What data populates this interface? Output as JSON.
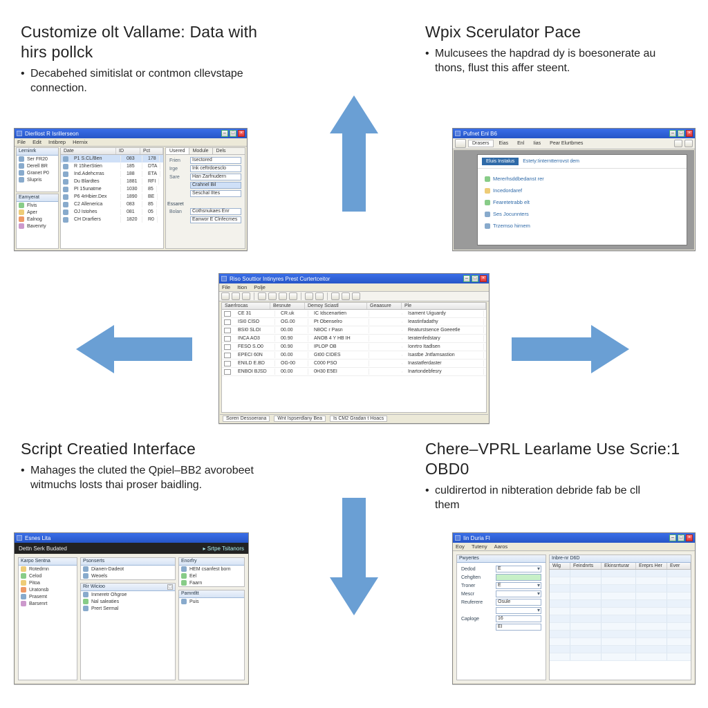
{
  "layout": {
    "arrows": [
      "up",
      "down",
      "left",
      "right"
    ]
  },
  "panels": {
    "topLeft": {
      "title": "Customize olt Vallame: Data with hirs pollck",
      "bullet": "Decabehed simitislat or contmon cllevstape connection.",
      "win": {
        "title": "Dierllost R Isrillerseon",
        "menus": [
          "File",
          "Edit",
          "Intibrep",
          "Hernix"
        ],
        "tree1_header": "Lerninrk",
        "tree1": [
          "Ser FR20",
          "Derell BR",
          "Granet P0",
          "Slupris"
        ],
        "tree2_header": "Eamyerat",
        "tree2": [
          "Flvis",
          "Aper",
          "Ealnog",
          "Bavenrty"
        ],
        "list_cols": [
          "Date",
          "ID",
          "Pct"
        ],
        "list": [
          [
            "P1 S.CL/Ben",
            "083",
            "178"
          ],
          [
            "R 15herStien",
            "185",
            "DTA"
          ],
          [
            "Ind.Adehcrras",
            "188",
            "ETA"
          ],
          [
            "Du Blardtes",
            "1881",
            "RFI"
          ],
          [
            "PI 15unatme",
            "1030",
            "85"
          ],
          [
            "P6 4rHbier.Dex",
            "1890",
            "BE"
          ],
          [
            "C2 Allenerica",
            "083",
            "85"
          ],
          [
            "OJ Istohes",
            "081",
            "05"
          ],
          [
            "CH Drarfiers",
            "1820",
            "R0"
          ]
        ],
        "propTabs": [
          "Usered",
          "Module",
          "Dels"
        ],
        "props": [
          [
            "Frien",
            "Isectored"
          ],
          [
            "Irge",
            "Ink ceftrdoesclo"
          ],
          [
            "Sare",
            "Han Zarfnudern"
          ],
          [
            "",
            "Crahnel Bil"
          ],
          [
            "",
            "Seschal IItes"
          ]
        ],
        "props2_label": "Essaret",
        "props2": [
          [
            "Bolan",
            "Cothsnukaes Enr"
          ],
          [
            "",
            "Eanwor E Clnfecmes"
          ]
        ]
      }
    },
    "topRight": {
      "title": "Wpix Scerulator Pace",
      "bullet": "Mulcusees the hapdrad dy is boesonerate au thons, flust this affer steent.",
      "win": {
        "title": "Pufnet Enl B6",
        "tabs": [
          "Drasers",
          "Eias",
          "Enl",
          "Iias",
          "Pear Elurtbmes"
        ],
        "headerBtn": "Eluis Instalus",
        "headerLink": "Estety:Iinterntterrovst dem",
        "items": [
          "Mererhsddbedanst rer",
          "Incedordaref",
          "Fearetetrabb elt",
          "Ses Jocunnters",
          "Trzemso hirnem"
        ]
      }
    },
    "center": {
      "title": "Riso Souttior Intinyres Prest Curtertceitor",
      "menus": [
        "File",
        "Ition",
        "Polje"
      ],
      "listCols": [
        "Saerlrocas",
        "Besnute",
        "Demoy Sciastl",
        "Geaasure",
        "Ple"
      ],
      "status": [
        "Soren Dessoerana",
        "Wnt Ispserdlany Bea",
        "Is CM2 Gradan t Hoacs"
      ],
      "rows": [
        [
          "CE 31",
          "CR.uk",
          "IC Idscenartien",
          "Isament Uiguardy",
          ""
        ],
        [
          "ISI0 ClSO",
          "OG.00",
          "Pt Obenselro",
          "Ieastinfadathy",
          ""
        ],
        [
          "BSI0 SLOI",
          "00.00",
          "N8OC r Pasn",
          "Reaturstsence Goeeetle",
          ""
        ],
        [
          "INCA AO3",
          "00.90",
          "ANOB 4 Y HB IH",
          "Ieratenfedstary",
          ""
        ],
        [
          "FESO S.O0",
          "00.90",
          "IPLOP OB",
          "Ionrtro Itadlsen",
          ""
        ],
        [
          "EPECI 60N",
          "00.00",
          "Gt00 CIDES",
          "Isastbe Jntfamsastion",
          ""
        ],
        [
          "ENILD E.BD",
          "OG-00",
          "C000 PSO",
          "Inastatferdaster",
          ""
        ],
        [
          "ENBOI BJSD",
          "00.00",
          "0H30 E5EI",
          "Inartondebfesry",
          ""
        ]
      ]
    },
    "botLeft": {
      "title": "Script Creatied Interface",
      "bullet": "Mahages the cluted the Qpiel–BB2 avorobeet witmuchs losts thai proser baidling.",
      "win": {
        "title": "Esnes Lita",
        "banner": "Dettn Serk Budated",
        "bannerRight": "Srtpe Tsitanors",
        "leftHeader": "Karpo Sentna",
        "leftItems": [
          "Rotedrnn",
          "Celod",
          "Pitoa",
          "Uratonsb",
          "Prasemt",
          "Barsenrt"
        ],
        "midHeader1": "Psonserts",
        "midItems1": [
          "Dianen-Dadeot",
          "Weoels"
        ],
        "midHeader2": "Rir Wicioo",
        "midItems2": [
          "Inmeretr Ohgroe",
          "Nal saleaties",
          "Prert Sermal"
        ],
        "rightHeader": "Enorfry",
        "rightItems": [
          "HEM csanfest born",
          "Eel",
          "Faarn"
        ],
        "rightHeader2": "Pamntltt",
        "rightItems2": [
          "Puis"
        ]
      }
    },
    "botRight": {
      "title": "Chere–VPRL Learlame Use Scrie:1 OBD0",
      "bullet": "culdirertod in nibteration debride fab be cll them",
      "win": {
        "title": "Iin Duria Fl",
        "menus": [
          "Eoy",
          "Tuteny",
          "Aaros"
        ],
        "formHeader": "Pwyertes",
        "gridHeader": "Inbre-nr D6D",
        "gridCols": [
          "Wig",
          "Feindnrts",
          "Ekinsrrturar",
          "Ereprs Her",
          "Ever"
        ],
        "fields": [
          {
            "label": "Dedod",
            "type": "dropdown",
            "value": "E"
          },
          {
            "label": "Cehglten",
            "type": "input",
            "value": "",
            "state": "green"
          },
          {
            "label": "Troner",
            "type": "dropdown",
            "value": "E"
          },
          {
            "label": "Mescr",
            "type": "dropdown",
            "value": ""
          },
          {
            "label": "Reuferere",
            "type": "input",
            "value": "Osule"
          },
          {
            "label": "",
            "type": "dropdown",
            "value": ""
          },
          {
            "label": "Caploge",
            "type": "input",
            "value": "16"
          },
          {
            "label": "",
            "type": "input",
            "value": "EI"
          }
        ]
      }
    }
  }
}
